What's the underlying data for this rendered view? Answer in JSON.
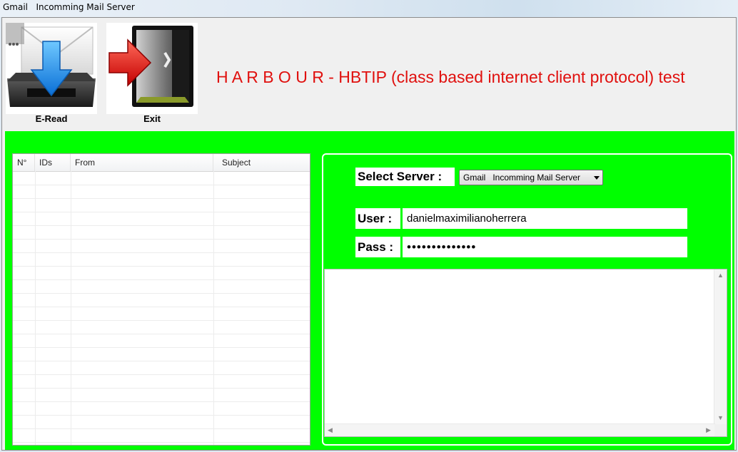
{
  "window": {
    "title": "Gmail   Incomming Mail Server"
  },
  "toolbar": {
    "eread_label": "E-Read",
    "exit_label": "Exit"
  },
  "banner": "H A R B O U R - HBTIP (class based internet client protocol) test",
  "colors": {
    "panel_bg": "#00ff00",
    "banner_text": "#e0100e"
  },
  "grid": {
    "columns": [
      "N°",
      "IDs",
      "From",
      "Subject"
    ],
    "rows": []
  },
  "form": {
    "server_label": "Select Server :",
    "server_value": "Gmail   Incomming Mail Server",
    "user_label": "User :",
    "user_value": "danielmaximilianoherrera",
    "pass_label": "Pass :",
    "pass_value": "••••••••••••••"
  },
  "icons": [
    "download-tray-icon",
    "exit-door-icon",
    "scroll-up-icon",
    "scroll-down-icon",
    "scroll-left-icon",
    "scroll-right-icon",
    "chevron-down-icon"
  ]
}
